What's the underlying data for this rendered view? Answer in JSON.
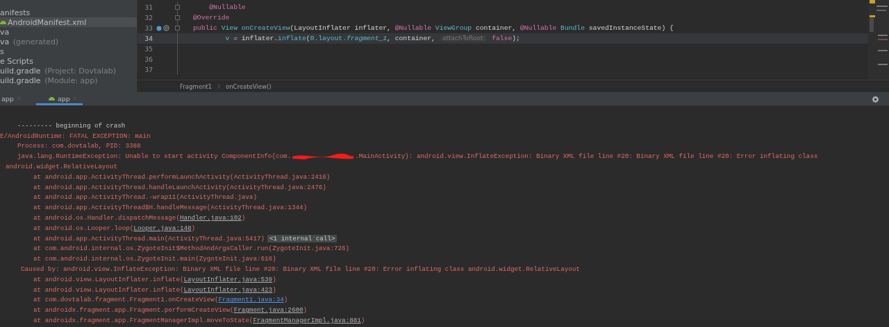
{
  "project_tree": {
    "items": [
      {
        "label": "anifests",
        "selected": false,
        "icon": false
      },
      {
        "label": "AndroidManifest.xml",
        "selected": true,
        "icon": true
      },
      {
        "label": "va",
        "selected": false,
        "icon": false
      },
      {
        "label": "va",
        "note": "(generated)",
        "selected": false,
        "icon": false
      },
      {
        "label": "s",
        "selected": false,
        "icon": false
      },
      {
        "label": "e Scripts",
        "selected": false,
        "icon": false
      },
      {
        "label": "uild.gradle",
        "note": "(Project: Dovtalab)",
        "selected": false,
        "icon": false
      },
      {
        "label": "uild.gradle",
        "note": "(Module: app)",
        "selected": false,
        "icon": false
      }
    ]
  },
  "editor": {
    "lines": [
      {
        "number": "31",
        "fold": true,
        "markers": false,
        "current": false,
        "tokens": [
          {
            "text": "    @Nullable",
            "kind": "annotation"
          }
        ]
      },
      {
        "number": "32",
        "fold": true,
        "markers": false,
        "current": false,
        "tokens": [
          {
            "text": "@Override",
            "kind": "annotation"
          }
        ]
      },
      {
        "number": "33",
        "fold": true,
        "markers": true,
        "current": false,
        "tokens": [
          {
            "text": "public ",
            "kind": "keyword"
          },
          {
            "text": "View ",
            "kind": "type"
          },
          {
            "text": "onCreateView",
            "kind": "type"
          },
          {
            "text": "(LayoutInflater ",
            "kind": "plain"
          },
          {
            "text": "inflater, ",
            "kind": "plain"
          },
          {
            "text": "@Nullable ",
            "kind": "annotation"
          },
          {
            "text": "ViewGroup ",
            "kind": "type"
          },
          {
            "text": "container, ",
            "kind": "plain"
          },
          {
            "text": "@Nullable ",
            "kind": "annotation"
          },
          {
            "text": "Bundle ",
            "kind": "type"
          },
          {
            "text": "savedInstanceState) {",
            "kind": "plain"
          }
        ]
      },
      {
        "number": "34",
        "fold": false,
        "markers": false,
        "current": true,
        "tokens": [
          {
            "text": "        v ",
            "kind": "type"
          },
          {
            "text": "= inflater.",
            "kind": "plain"
          },
          {
            "text": "inflate",
            "kind": "type"
          },
          {
            "text": "(",
            "kind": "plain"
          },
          {
            "text": "R.layout.",
            "kind": "type"
          },
          {
            "text": "fragment_1",
            "kind": "field"
          },
          {
            "text": ", container, ",
            "kind": "plain"
          },
          {
            "text": "attachToRoot:",
            "kind": "hint"
          },
          {
            "text": " false",
            "kind": "keyword"
          },
          {
            "text": ");",
            "kind": "plain"
          }
        ]
      },
      {
        "number": "35",
        "fold": false,
        "markers": false,
        "current": false
      },
      {
        "number": "36",
        "fold": false,
        "markers": false,
        "current": false
      },
      {
        "number": "37",
        "fold": false,
        "markers": false,
        "current": false
      }
    ],
    "breadcrumbs": [
      "Fragment1",
      "onCreateView()"
    ]
  },
  "run_tabs": [
    {
      "label": "app",
      "selected": false
    },
    {
      "label": "app",
      "selected": true
    }
  ],
  "console": {
    "lines": [
      {
        "kind": "header",
        "parts": [
          {
            "text": "--------- beginning of crash"
          }
        ]
      },
      {
        "kind": "fatal",
        "parts": [
          {
            "text": "E/AndroidRuntime: FATAL EXCEPTION: main"
          }
        ]
      },
      {
        "kind": "info",
        "parts": [
          {
            "text": "Process: com.dovtalab, PID: 3388"
          }
        ]
      },
      {
        "kind": "info",
        "parts": [
          {
            "text": "java.lang.RuntimeException: Unable to start activity ComponentInfo{com."
          },
          {
            "kind": "redacted"
          },
          {
            "text": ".MainActivity}: android.view.InflateException: Binary XML file line #20: Binary XML file line #20: Error inflating class"
          }
        ]
      },
      {
        "kind": "continuation",
        "parts": [
          {
            "text": "android.widget.RelativeLayout"
          }
        ]
      },
      {
        "kind": "frame",
        "parts": [
          {
            "text": "at android.app.ActivityThread.performLaunchActivity(ActivityThread.java:2416)"
          }
        ]
      },
      {
        "kind": "frame",
        "parts": [
          {
            "text": "at android.app.ActivityThread.handleLaunchActivity(ActivityThread.java:2476)"
          }
        ]
      },
      {
        "kind": "frame",
        "parts": [
          {
            "text": "at android.app.ActivityThread.-wrap11(ActivityThread.java)"
          }
        ]
      },
      {
        "kind": "frame",
        "parts": [
          {
            "text": "at android.app.ActivityThread$H.handleMessage(ActivityThread.java:1344)"
          }
        ]
      },
      {
        "kind": "frame",
        "parts": [
          {
            "text": "at android.os.Handler.dispatchMessage("
          },
          {
            "kind": "link",
            "text": "Handler.java:102"
          },
          {
            "text": ")"
          }
        ]
      },
      {
        "kind": "frame",
        "parts": [
          {
            "text": "at android.os.Looper.loop("
          },
          {
            "kind": "link",
            "text": "Looper.java:148"
          },
          {
            "text": ")"
          }
        ]
      },
      {
        "kind": "frame",
        "parts": [
          {
            "text": "at android.app.ActivityThread.main(ActivityThread.java:5417)"
          },
          {
            "kind": "badge",
            "text": "<1 internal call>"
          }
        ]
      },
      {
        "kind": "frame",
        "parts": [
          {
            "text": "at com.android.internal.os.ZygoteInit$MethodAndArgsCaller.run(ZygoteInit.java:726)"
          }
        ]
      },
      {
        "kind": "frame",
        "parts": [
          {
            "text": "at com.android.internal.os.ZygoteInit.main(ZygoteInit.java:616)"
          }
        ]
      },
      {
        "kind": "cause",
        "parts": [
          {
            "text": "Caused by: android.view.InflateException: Binary XML file line #20: Binary XML file line #20: Error inflating class android.widget.RelativeLayout"
          }
        ]
      },
      {
        "kind": "frame",
        "parts": [
          {
            "text": "at android.view.LayoutInflater.inflate("
          },
          {
            "kind": "link",
            "text": "LayoutInflater.java:539"
          },
          {
            "text": ")"
          }
        ]
      },
      {
        "kind": "frame",
        "parts": [
          {
            "text": "at android.view.LayoutInflater.inflate("
          },
          {
            "kind": "link",
            "text": "LayoutInflater.java:423"
          },
          {
            "text": ")"
          }
        ]
      },
      {
        "kind": "frame",
        "parts": [
          {
            "text": "at com.dovtalab.fragment.Fragment1.onCreateView("
          },
          {
            "kind": "source",
            "text": "Fragment1.java:34"
          },
          {
            "text": ")"
          }
        ]
      },
      {
        "kind": "frame",
        "parts": [
          {
            "text": "at androidx.fragment.app.Fragment.performCreateView("
          },
          {
            "kind": "link",
            "text": "Fragment.java:2600"
          },
          {
            "text": ")"
          }
        ]
      },
      {
        "kind": "frame",
        "parts": [
          {
            "text": "at androidx.fragment.app.FragmentManagerImpl.moveToState("
          },
          {
            "kind": "link",
            "text": "FragmentManagerImpl.java:881"
          },
          {
            "text": ")"
          }
        ]
      }
    ]
  }
}
